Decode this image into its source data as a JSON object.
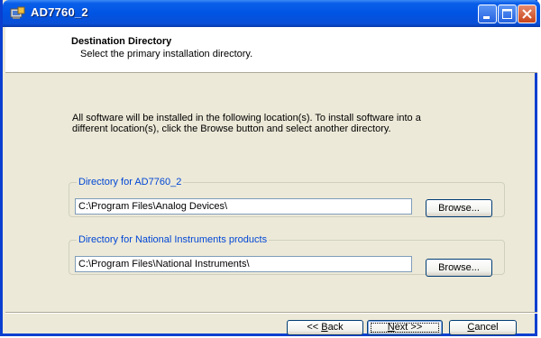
{
  "window": {
    "title": "AD7760_2",
    "icon": "installer-app-icon",
    "controls": [
      "minimize-icon",
      "maximize-icon",
      "close-icon"
    ]
  },
  "header": {
    "title": "Destination Directory",
    "subtitle": "Select the primary installation directory."
  },
  "description": "All software will be installed in the following location(s). To install software into a different location(s), click the Browse button and select another directory.",
  "groups": [
    {
      "legend": "Directory for AD7760_2",
      "path": "C:\\Program Files\\Analog Devices\\",
      "browse_label": "Browse..."
    },
    {
      "legend": "Directory for National Instruments products",
      "path": "C:\\Program Files\\National Instruments\\",
      "browse_label": "Browse..."
    }
  ],
  "nav": {
    "back_prefix": "<< ",
    "back_accel": "B",
    "back_rest": "ack",
    "next_accel": "N",
    "next_rest": "ext >>",
    "cancel_accel": "C",
    "cancel_rest": "ancel"
  },
  "colors": {
    "titlebar": "#0054e3",
    "face": "#ece9d8",
    "legend": "#0046d5"
  }
}
